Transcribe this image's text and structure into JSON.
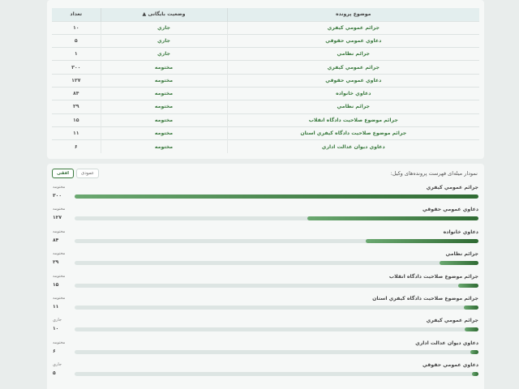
{
  "table": {
    "headers": {
      "topic": "موضوع پرونده",
      "status": "وضعیت بایگانی ▲",
      "count": "تعداد"
    },
    "rows": [
      {
        "topic": "جرائم عمومي كيفري",
        "status": "جاري",
        "count": "۱۰"
      },
      {
        "topic": "دعاوي عمومي حقوقي",
        "status": "جاري",
        "count": "۵"
      },
      {
        "topic": "جرائم نظامي",
        "status": "جاري",
        "count": "۱"
      },
      {
        "topic": "جرائم عمومي كيفري",
        "status": "مختومه",
        "count": "۳۰۰"
      },
      {
        "topic": "دعاوي عمومي حقوقي",
        "status": "مختومه",
        "count": "۱۲۷"
      },
      {
        "topic": "دعاوي خانواده",
        "status": "مختومه",
        "count": "۸۴"
      },
      {
        "topic": "جرائم نظامي",
        "status": "مختومه",
        "count": "۲۹"
      },
      {
        "topic": "جرائم موضوع صلاحيت دادگاه انقلاب",
        "status": "مختومه",
        "count": "۱۵"
      },
      {
        "topic": "جرائم موضوع صلاحيت دادگاه كيفري استان",
        "status": "مختومه",
        "count": "۱۱"
      },
      {
        "topic": "دعاوي ديوان عدالت اداري",
        "status": "مختومه",
        "count": "۶"
      }
    ]
  },
  "chart": {
    "title": "نمودار میله‌ای فهرست پرونده‌های وکیل:",
    "toggle_horizontal": "افقی",
    "toggle_vertical": "عمودی"
  },
  "chart_data": {
    "type": "bar",
    "orientation": "horizontal",
    "title": "نمودار میله‌ای فهرست پرونده‌های وکیل:",
    "xlim": [
      0,
      300
    ],
    "bars": [
      {
        "label": "جرائم عمومي كيفري",
        "status": "مختومه",
        "value": 300,
        "display": "۳۰۰"
      },
      {
        "label": "دعاوي عمومي حقوقي",
        "status": "مختومه",
        "value": 127,
        "display": "۱۲۷"
      },
      {
        "label": "دعاوي خانواده",
        "status": "مختومه",
        "value": 84,
        "display": "۸۴"
      },
      {
        "label": "جرائم نظامي",
        "status": "مختومه",
        "value": 29,
        "display": "۲۹"
      },
      {
        "label": "جرائم موضوع صلاحيت دادگاه انقلاب",
        "status": "مختومه",
        "value": 15,
        "display": "۱۵"
      },
      {
        "label": "جرائم موضوع صلاحيت دادگاه كيفري استان",
        "status": "مختومه",
        "value": 11,
        "display": "۱۱"
      },
      {
        "label": "جرائم عمومي كيفري",
        "status": "جاري",
        "value": 10,
        "display": "۱۰"
      },
      {
        "label": "دعاوي ديوان عدالت اداري",
        "status": "مختومه",
        "value": 6,
        "display": "۶"
      },
      {
        "label": "دعاوي عمومي حقوقي",
        "status": "جاري",
        "value": 5,
        "display": "۵"
      }
    ]
  }
}
